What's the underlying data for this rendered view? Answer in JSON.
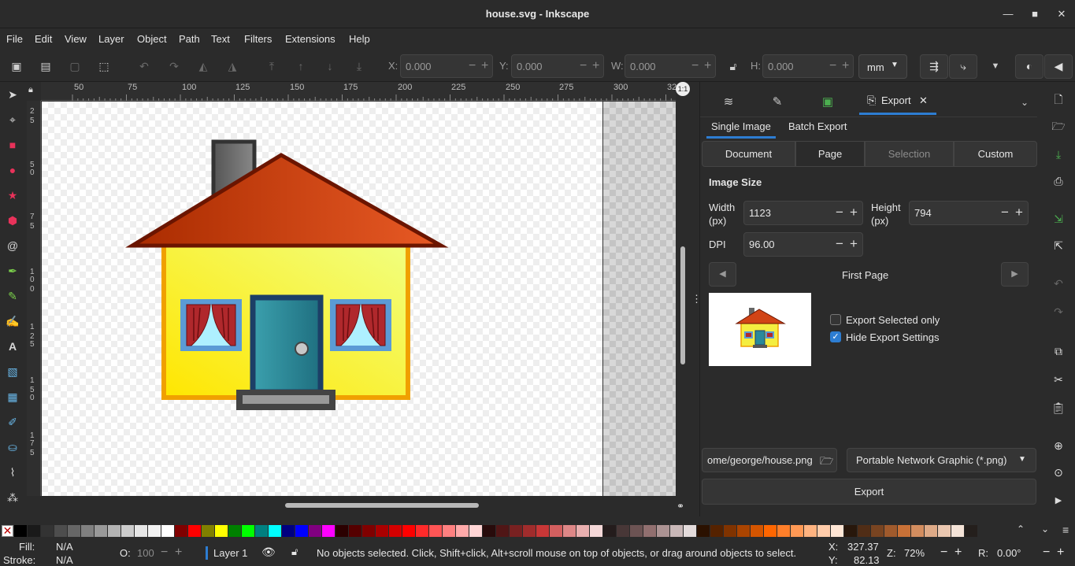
{
  "window": {
    "title": "house.svg - Inkscape",
    "min_icon": "minimize-icon",
    "max_icon": "maximize-icon",
    "close_icon": "close-icon"
  },
  "menu": [
    "File",
    "Edit",
    "View",
    "Layer",
    "Object",
    "Path",
    "Text",
    "Filters",
    "Extensions",
    "Help"
  ],
  "toolbar": {
    "x_label": "X:",
    "x_value": "0.000",
    "y_label": "Y:",
    "y_value": "0.000",
    "w_label": "W:",
    "w_value": "0.000",
    "h_label": "H:",
    "h_value": "0.000",
    "unit": "mm"
  },
  "ruler_top": [
    "50",
    "75",
    "100",
    "125",
    "150",
    "175",
    "200",
    "225",
    "250",
    "275",
    "300",
    "32"
  ],
  "ruler_left": [
    "2",
    "5",
    "5",
    "0",
    "7",
    "5",
    "1",
    "0",
    "0",
    "1",
    "2",
    "5",
    "1",
    "5",
    "0",
    "1",
    "7",
    "5"
  ],
  "dock": {
    "export_tab": "Export",
    "sub_tabs": [
      "Single Image",
      "Batch Export"
    ],
    "area_buttons": [
      "Document",
      "Page",
      "Selection",
      "Custom"
    ],
    "active_area": "Page",
    "image_size_title": "Image Size",
    "width_label": "Width\n(px)",
    "width_value": "1123",
    "height_label": "Height\n(px)",
    "height_value": "794",
    "dpi_label": "DPI",
    "dpi_value": "96.00",
    "page_name": "First Page",
    "export_selected_only": "Export Selected only",
    "export_selected_checked": false,
    "hide_export_settings": "Hide Export Settings",
    "hide_export_checked": true,
    "filename": "ome/george/house.png",
    "format": "Portable Network Graphic (*.png)",
    "export_button": "Export"
  },
  "status": {
    "fill_label": "Fill:",
    "fill_value": "N/A",
    "stroke_label": "Stroke:",
    "stroke_value": "N/A",
    "opacity_label": "O:",
    "opacity_value": "100",
    "layer": "Layer 1",
    "message": "No objects selected. Click, Shift+click, Alt+scroll mouse on top of objects, or drag around objects to select.",
    "x_label": "X:",
    "x_value": "327.37",
    "y_label": "Y:",
    "y_value": "82.13",
    "zoom_label": "Z:",
    "zoom_value": "72%",
    "rot_label": "R:",
    "rot_value": "0.00°"
  },
  "palette_colors": [
    "#000000",
    "#1a1a1a",
    "#333333",
    "#4d4d4d",
    "#666666",
    "#808080",
    "#999999",
    "#b3b3b3",
    "#cccccc",
    "#e6e6e6",
    "#f2f2f2",
    "#ffffff",
    "#800000",
    "#ff0000",
    "#808000",
    "#ffff00",
    "#008000",
    "#00ff00",
    "#008080",
    "#00ffff",
    "#000080",
    "#0000ff",
    "#800080",
    "#ff00ff",
    "#2b0000",
    "#550000",
    "#800000",
    "#aa0000",
    "#d40000",
    "#ff0000",
    "#ff2a2a",
    "#ff5555",
    "#ff8080",
    "#ffaaaa",
    "#ffd5d5",
    "#280b0b",
    "#501616",
    "#782121",
    "#a02c2c",
    "#c83737",
    "#d35f5f",
    "#de8787",
    "#e9afaf",
    "#f4d7d7",
    "#241c1c",
    "#483737",
    "#6c5353",
    "#916f6f",
    "#ac9393",
    "#c8b7b7",
    "#e3dbdb",
    "#2b1100",
    "#552200",
    "#803300",
    "#aa4400",
    "#d45500",
    "#ff6600",
    "#ff7f2a",
    "#ff9955",
    "#ffb380",
    "#ffccaa",
    "#ffe6d5",
    "#28170b",
    "#502d16",
    "#784421",
    "#a05a2c",
    "#c87137",
    "#d38d5f",
    "#deaa87",
    "#e9c6af",
    "#f4e3d7",
    "#241f1c"
  ]
}
